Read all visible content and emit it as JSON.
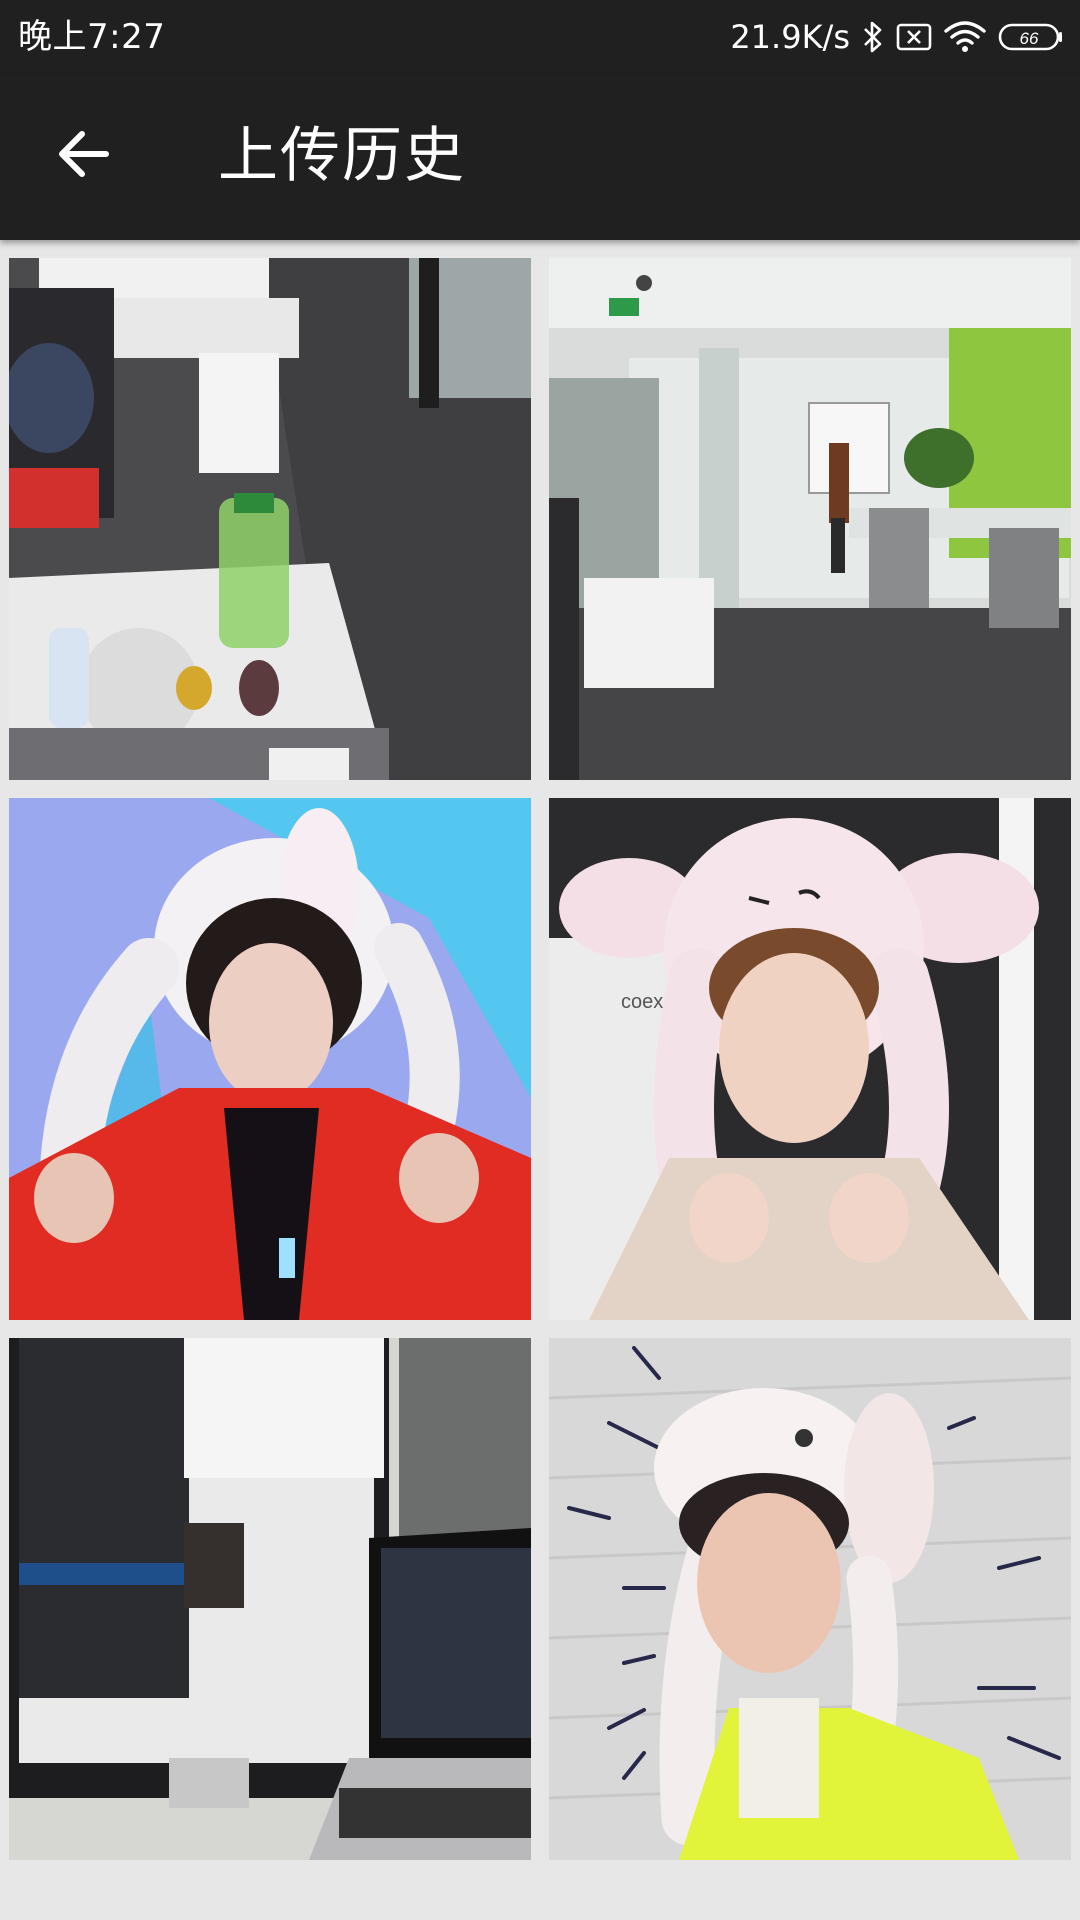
{
  "status_bar": {
    "time": "晚上7:27",
    "network_speed": "21.9K/s",
    "battery_level": "66",
    "icons": [
      "bluetooth-icon",
      "sim-disabled-icon",
      "wifi-icon",
      "battery-icon"
    ]
  },
  "app_bar": {
    "title": "上传历史",
    "back_icon": "arrow-left-icon"
  },
  "gallery": {
    "items": [
      {
        "index": 1,
        "kind": "photo"
      },
      {
        "index": 2,
        "kind": "photo"
      },
      {
        "index": 3,
        "kind": "photo"
      },
      {
        "index": 4,
        "kind": "photo",
        "visible_text": "coex"
      },
      {
        "index": 5,
        "kind": "photo"
      },
      {
        "index": 6,
        "kind": "photo"
      }
    ]
  },
  "colors": {
    "bar_background": "#202020",
    "page_background": "#e7e7e7",
    "foreground": "#ffffff"
  }
}
